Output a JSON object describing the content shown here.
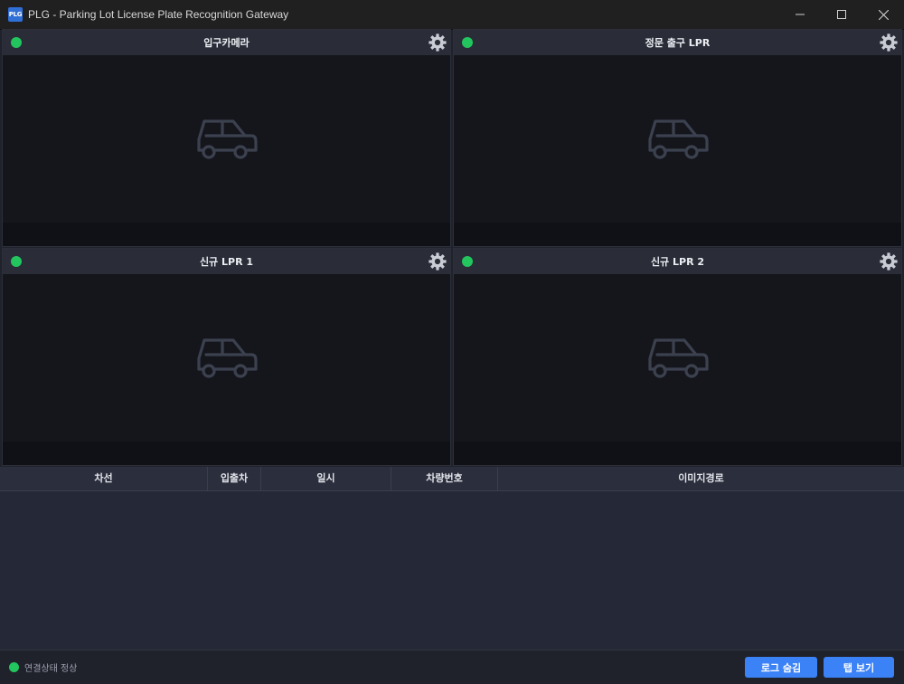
{
  "window": {
    "title": "PLG - Parking Lot License Plate Recognition Gateway",
    "icon_label": "PLG"
  },
  "cameras": [
    {
      "title": "입구카메라",
      "status": "online"
    },
    {
      "title": "정문 출구 LPR",
      "status": "online"
    },
    {
      "title": "신규 LPR 1",
      "status": "online"
    },
    {
      "title": "신규 LPR 2",
      "status": "online"
    }
  ],
  "table": {
    "columns": [
      "차선",
      "입출차",
      "일시",
      "차량번호",
      "이미지경로"
    ],
    "rows": []
  },
  "statusbar": {
    "text": "연결상태 정상",
    "hide_log_label": "로그 숨김",
    "tab_view_label": "탭 보기"
  },
  "colors": {
    "online": "#22c55e",
    "button": "#3b82f6"
  }
}
